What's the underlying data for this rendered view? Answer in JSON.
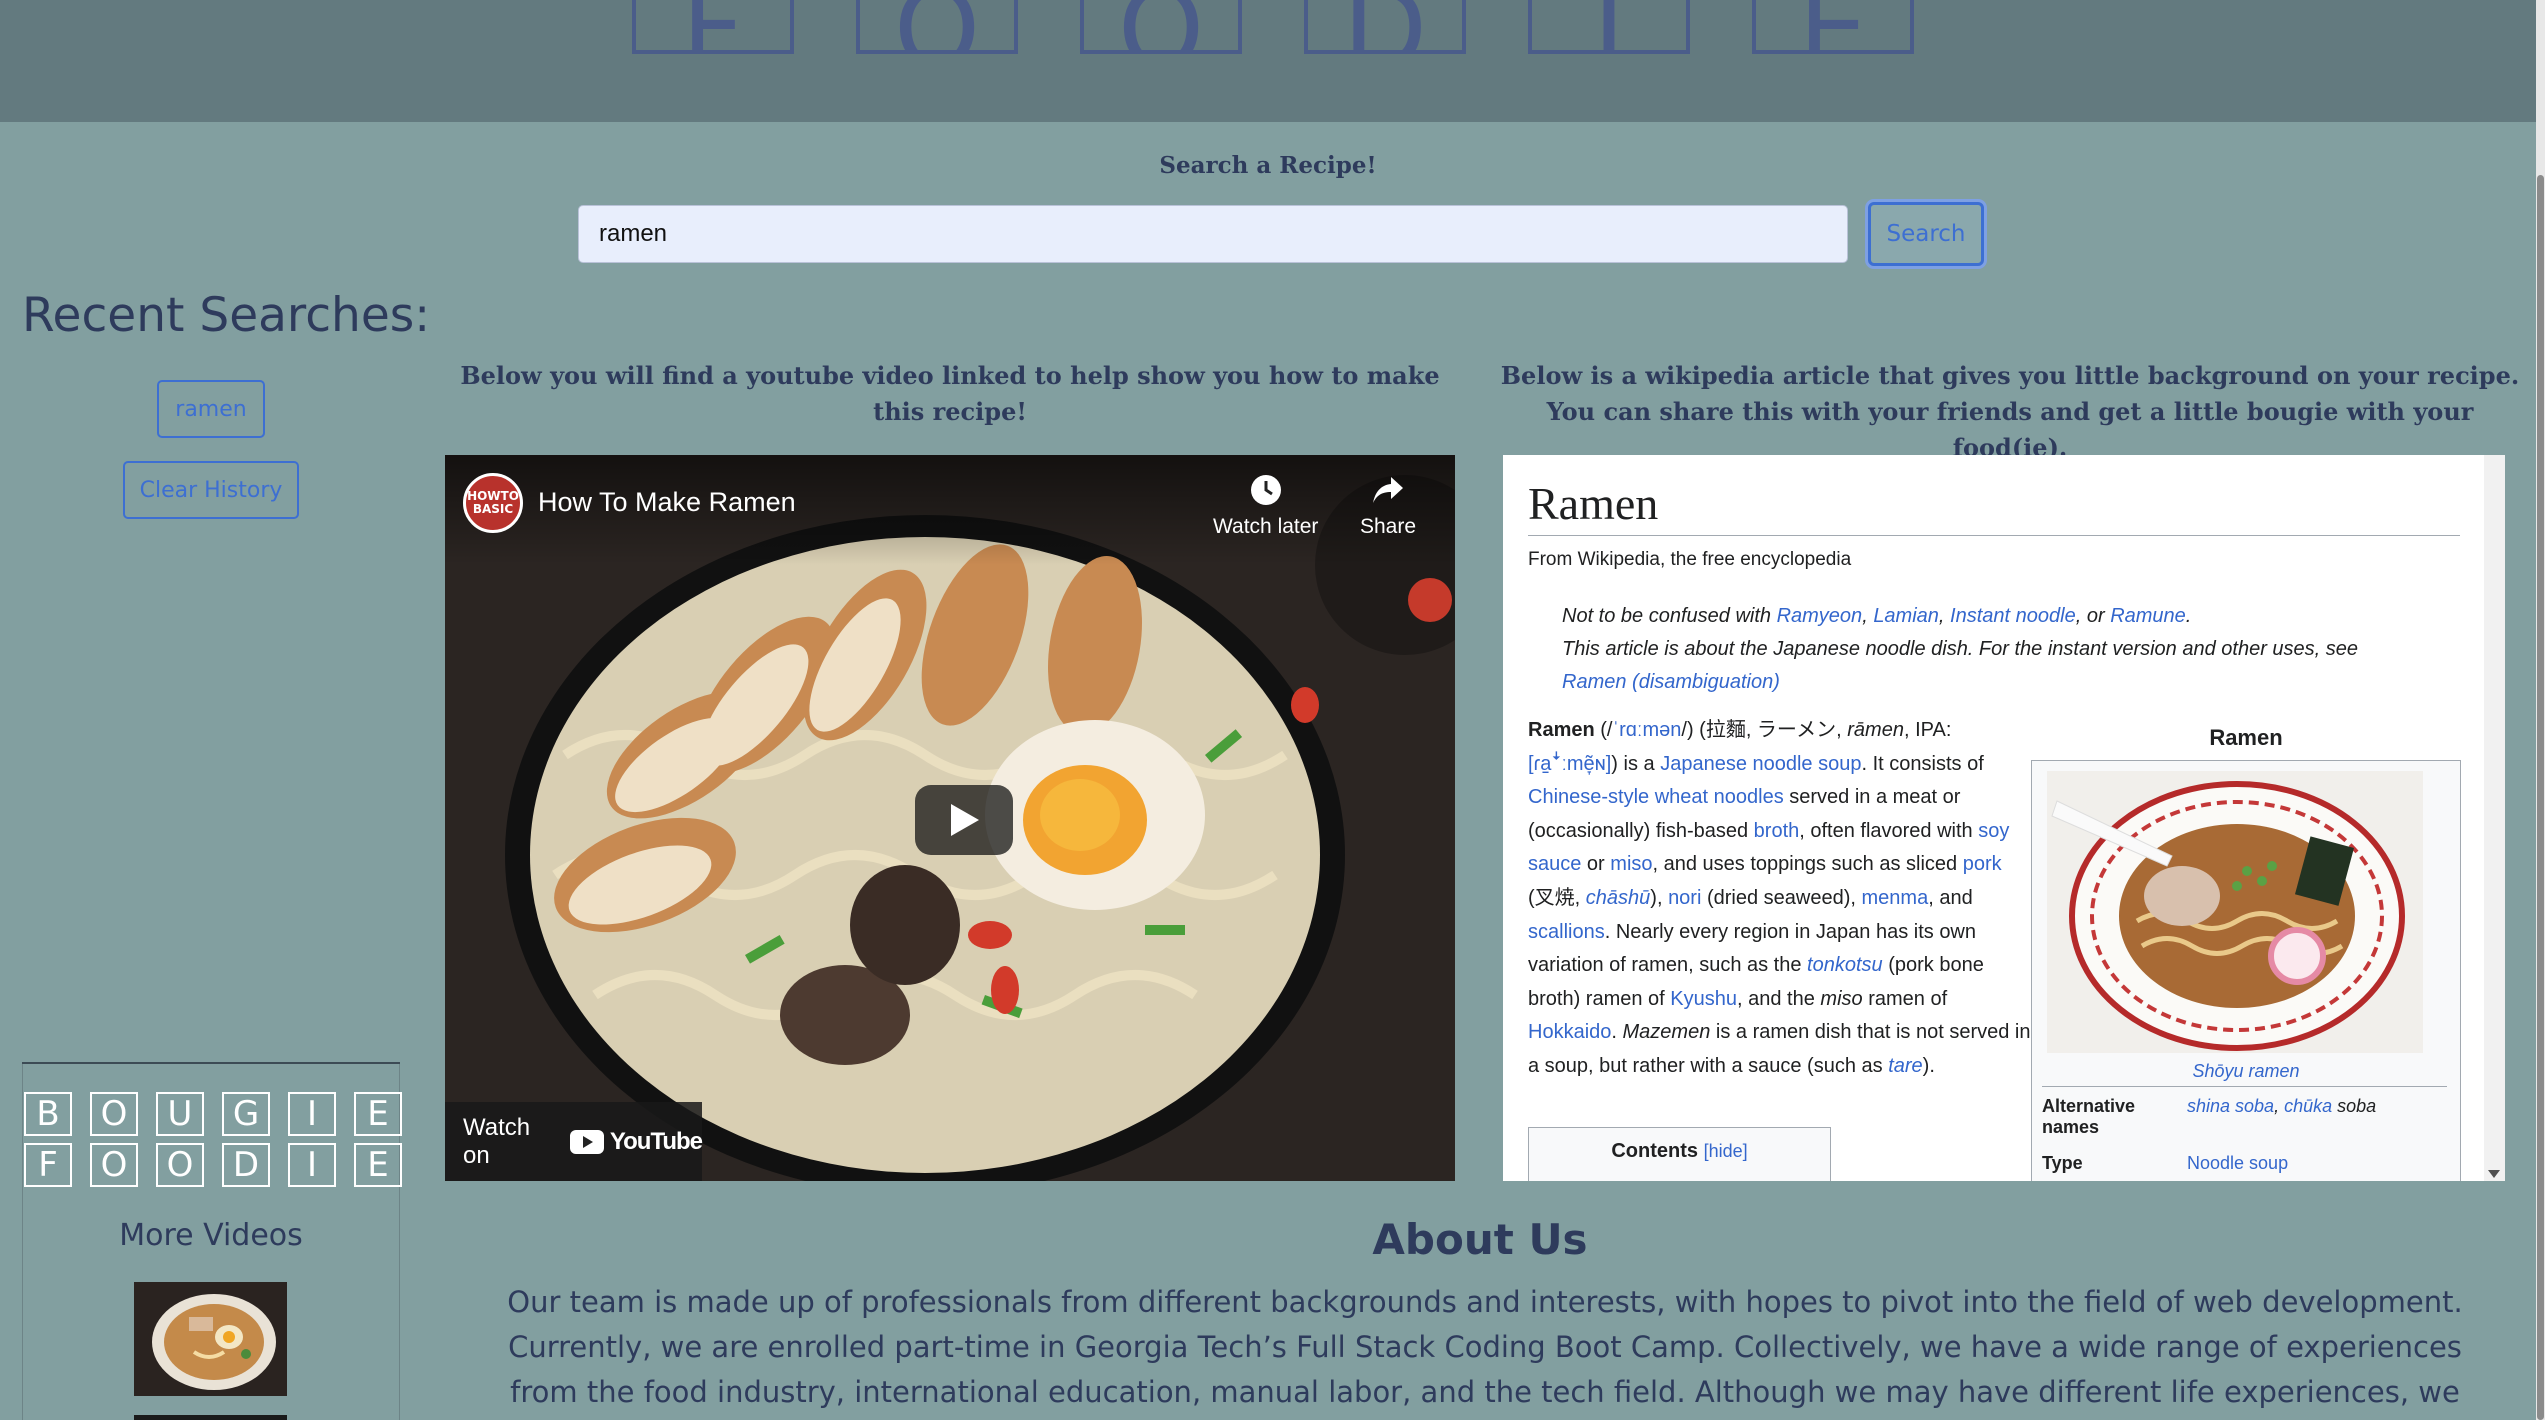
{
  "header": {
    "logo_letters": [
      "F",
      "O",
      "O",
      "D",
      "I",
      "E"
    ]
  },
  "search": {
    "label": "Search a Recipe!",
    "value": "ramen",
    "button_label": "Search"
  },
  "sidebar": {
    "recent_title": "Recent Searches:",
    "recent_items": [
      "ramen"
    ],
    "clear_label": "Clear History",
    "logo_row1": [
      "B",
      "O",
      "U",
      "G",
      "I",
      "E"
    ],
    "logo_row2": [
      "F",
      "O",
      "O",
      "D",
      "I",
      "E"
    ],
    "more_videos": "More Videos"
  },
  "youtube": {
    "heading": "Below you will find a youtube video linked to help show you how to make this recipe!",
    "title": "How To Make Ramen",
    "channel_label": "HOWTO BASIC",
    "watch_later": "Watch later",
    "share": "Share",
    "watch_on": "Watch on",
    "youtube_logo": "YouTube"
  },
  "wiki": {
    "heading": "Below is a wikipedia article that gives you little background on your recipe. You can share this with your friends and get a little bougie with your food(ie).",
    "title": "Ramen",
    "from": "From Wikipedia, the free encyclopedia",
    "hatnote1_prefix": "Not to be confused with ",
    "hatnote1_links": [
      "Ramyeon",
      "Lamian",
      "Instant noodle"
    ],
    "hatnote1_or": "or",
    "hatnote1_last": "Ramune",
    "hatnote2": "This article is about the Japanese noodle dish. For the instant version and other uses, see",
    "hatnote2_link": "Ramen (disambiguation)",
    "infobox_title": "Ramen",
    "infobox_caption": "Shōyu ramen",
    "alt_names_label": "Alternative names",
    "alt_names_value1": "shina soba",
    "alt_names_value2": "chūka",
    "alt_names_value3": "soba",
    "type_label": "Type",
    "type_value": "Noodle soup",
    "contents_label": "Contents",
    "contents_hide": "[hide]"
  },
  "about": {
    "title": "About Us",
    "text": "Our team is made up of professionals from different backgrounds and interests, with hopes to pivot into the field of web development. Currently, we are enrolled part-time in Georgia Tech’s Full Stack Coding Boot Camp. Collectively, we have a wide range of experiences from the food industry, international education, manual labor, and the tech field. Although we may have different life experiences, we came together with a common goal to"
  },
  "colors": {
    "accent": "#3d6fd2",
    "background": "#829fa0",
    "header": "#637a7f",
    "text": "#2e3b5c"
  }
}
